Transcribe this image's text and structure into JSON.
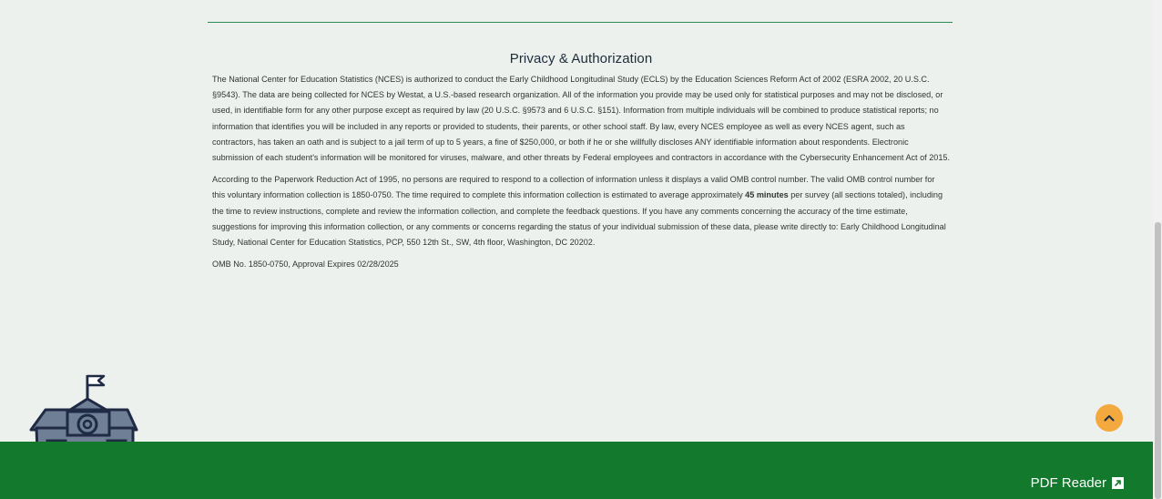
{
  "privacy": {
    "title": "Privacy & Authorization",
    "paragraph1": "The National Center for Education Statistics (NCES) is authorized to conduct the Early Childhood Longitudinal Study (ECLS) by the Education Sciences Reform Act of 2002 (ESRA 2002, 20 U.S.C. §9543). The data are being collected for NCES by Westat, a U.S.-based research organization. All of the information you provide may be used only for statistical purposes and may not be disclosed, or used, in identifiable form for any other purpose except as required by law (20 U.S.C. §9573 and 6 U.S.C. §151). Information from multiple individuals will be combined to produce statistical reports; no information that identifies you will be included in any reports or provided to students, their parents, or other school staff. By law, every NCES employee as well as every NCES agent, such as contractors, has taken an oath and is subject to a jail term of up to 5 years, a fine of $250,000, or both if he or she willfully discloses ANY identifiable information about respondents. Electronic submission of each student's information will be monitored for viruses, malware, and other threats by Federal employees and contractors in accordance with the Cybersecurity Enhancement Act of 2015.",
    "paragraph2_before": "According to the Paperwork Reduction Act of 1995, no persons are required to respond to a collection of information unless it displays a valid OMB control number. The valid OMB control number for this voluntary information collection is 1850-0750. The time required to complete this information collection is estimated to average approximately ",
    "paragraph2_bold": "45 minutes",
    "paragraph2_after": " per survey (all sections totaled), including the time to review instructions, complete and review the information collection, and complete the feedback questions. If you have any comments concerning the accuracy of the time estimate, suggestions for improving this information collection, or any comments or concerns regarding the status of your individual submission of these data, please write directly to: Early Childhood Longitudinal Study, National Center for Education Statistics, PCP, 550 12th St., SW, 4th floor, Washington, DC 20202.",
    "omb": "OMB No. 1850-0750, Approval Expires 02/28/2025"
  },
  "footer": {
    "pdf_reader_label": "PDF Reader",
    "pdf_reader_icon": "external-link-icon",
    "background_color": "#137a2d"
  },
  "scroll_top": {
    "icon": "chevron-up-icon",
    "color": "#f3a93d"
  },
  "school_illustration": {
    "icon": "school-building-icon"
  }
}
